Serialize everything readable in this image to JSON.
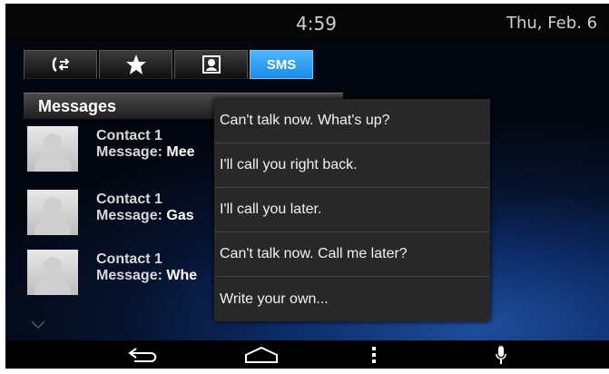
{
  "status": {
    "time": "4:59",
    "date": "Thu, Feb. 6"
  },
  "tabs": [
    {
      "icon": "call-log-icon"
    },
    {
      "icon": "favorites-star-icon"
    },
    {
      "icon": "contacts-icon"
    },
    {
      "label": "SMS",
      "active": true
    }
  ],
  "messages": {
    "title": "Messages",
    "items": [
      {
        "contact": "Contact 1",
        "label": "Message:",
        "preview": "Mee"
      },
      {
        "contact": "Contact 1",
        "label": "Message:",
        "preview": "Gas"
      },
      {
        "contact": "Contact 1",
        "label": "Message:",
        "preview": "Whe"
      }
    ]
  },
  "quick_replies": [
    "Can't talk now. What's up?",
    "I'll call you right back.",
    "I'll call you later.",
    "Can't talk now. Call me later?",
    "Write your own..."
  ],
  "navbar": [
    "back-icon",
    "home-icon",
    "menu-icon",
    "microphone-icon"
  ],
  "colors": {
    "accent": "#1a8be6",
    "popup": "#282828"
  }
}
